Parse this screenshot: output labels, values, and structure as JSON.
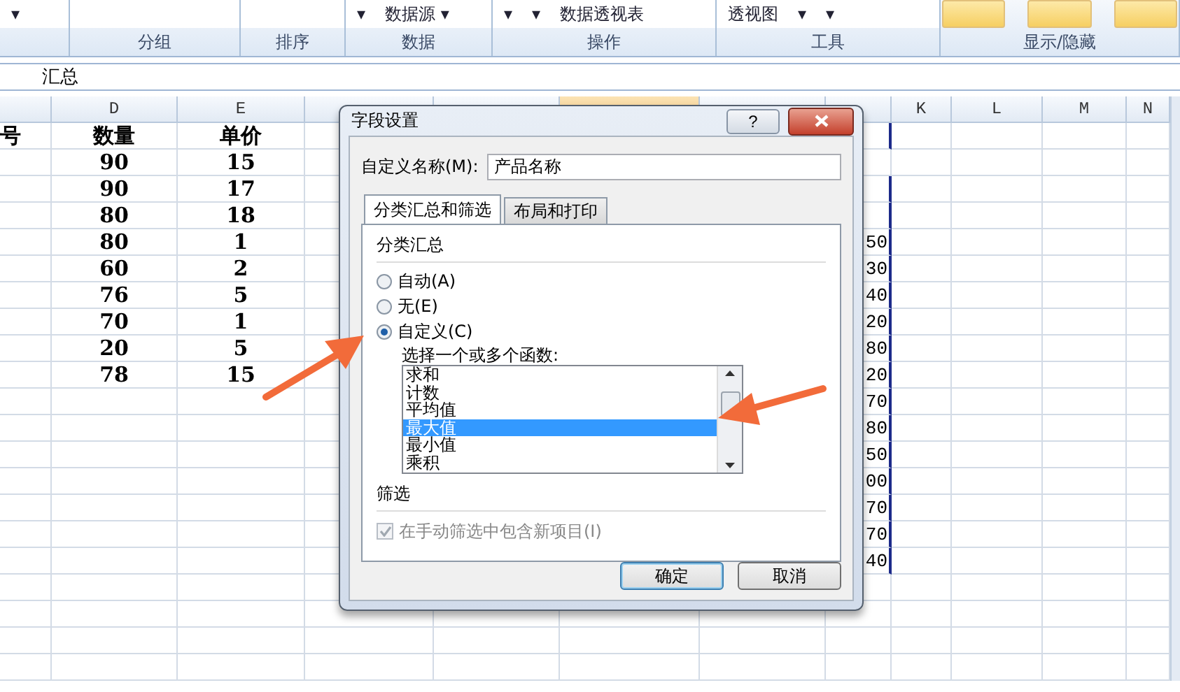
{
  "ribbon": {
    "groups": [
      {
        "items": [
          {
            "text": "▾"
          }
        ]
      },
      {
        "label": "分组"
      },
      {
        "label": "排序"
      },
      {
        "label": "数据",
        "items": [
          {
            "text": "▾"
          },
          {
            "text": "数据源 ▾"
          }
        ]
      },
      {
        "label": "操作",
        "items": [
          {
            "text": "▾"
          },
          {
            "text": "▾"
          },
          {
            "text": "数据透视表"
          }
        ]
      },
      {
        "label": "工具",
        "items": [
          {
            "text": "透视图"
          },
          {
            "text": "▾"
          },
          {
            "text": "▾"
          }
        ]
      },
      {
        "label": "显示/隐藏",
        "kind": "gallery"
      }
    ]
  },
  "formula_bar": {
    "value": "汇总"
  },
  "sheet": {
    "columns": [
      {
        "selected": false
      },
      {
        "label": "D",
        "selected": false
      },
      {
        "label": "E",
        "selected": false
      },
      {
        "selected": false
      },
      {
        "selected": false
      },
      {
        "selected": true
      },
      {
        "selected": false
      },
      {
        "selected": false
      },
      {
        "label": "K",
        "selected": false
      },
      {
        "label": "L",
        "selected": false
      },
      {
        "label": "M",
        "selected": false
      },
      {
        "label": "N",
        "selected": false
      }
    ],
    "rows": [
      {
        "column_1": "号",
        "d": "数量",
        "e": "单价",
        "boxed": true
      },
      {
        "d": "90",
        "e": "15",
        "boxed": false
      },
      {
        "d": "90",
        "e": "17",
        "boxed": true
      },
      {
        "d": "80",
        "e": "18",
        "boxed": true
      },
      {
        "d": "80",
        "e": "1",
        "j": "50",
        "boxed": true
      },
      {
        "d": "60",
        "e": "2",
        "j": "30",
        "boxed": true
      },
      {
        "d": "76",
        "e": "5",
        "j": "40",
        "boxed": true
      },
      {
        "d": "70",
        "e": "1",
        "j": "20",
        "boxed": true
      },
      {
        "d": "20",
        "e": "5",
        "j": "80",
        "boxed": true
      },
      {
        "d": "78",
        "e": "15",
        "j": "20",
        "boxed": true
      },
      {
        "j": "70",
        "boxed": true
      },
      {
        "j": "80",
        "boxed": true
      },
      {
        "j": "50",
        "boxed": true
      },
      {
        "j": "00",
        "boxed": true
      },
      {
        "j": "70",
        "boxed": true
      },
      {
        "j": "70",
        "boxed": true
      },
      {
        "j": "40",
        "boxed": true
      },
      {
        "boxed": false
      },
      {
        "boxed": false
      },
      {
        "boxed": false
      },
      {
        "boxed": false
      }
    ]
  },
  "dialog": {
    "title": "字段设置",
    "help_label": "?",
    "name_label": "自定义名称(M):",
    "name_value": "产品名称",
    "tabs": [
      {
        "label": "分类汇总和筛选",
        "selected": true
      },
      {
        "label": "布局和打印",
        "selected": false
      }
    ],
    "subtotal_heading": "分类汇总",
    "radios": [
      {
        "label": "自动(A)",
        "selected": false
      },
      {
        "label": "无(E)",
        "selected": false
      },
      {
        "label": "自定义(C)",
        "selected": true
      }
    ],
    "function_label": "选择一个或多个函数:",
    "functions": [
      {
        "label": "求和",
        "selected": false
      },
      {
        "label": "计数",
        "selected": false
      },
      {
        "label": "平均值",
        "selected": false
      },
      {
        "label": "最大值",
        "selected": true
      },
      {
        "label": "最小值",
        "selected": false
      },
      {
        "label": "乘积",
        "selected": false
      }
    ],
    "filter_heading": "筛选",
    "filter_option": {
      "label": "在手动筛选中包含新项目(I)",
      "checked": true,
      "disabled": true
    },
    "buttons": [
      {
        "label": "确定",
        "default": true
      },
      {
        "label": "取消",
        "default": false
      }
    ]
  }
}
